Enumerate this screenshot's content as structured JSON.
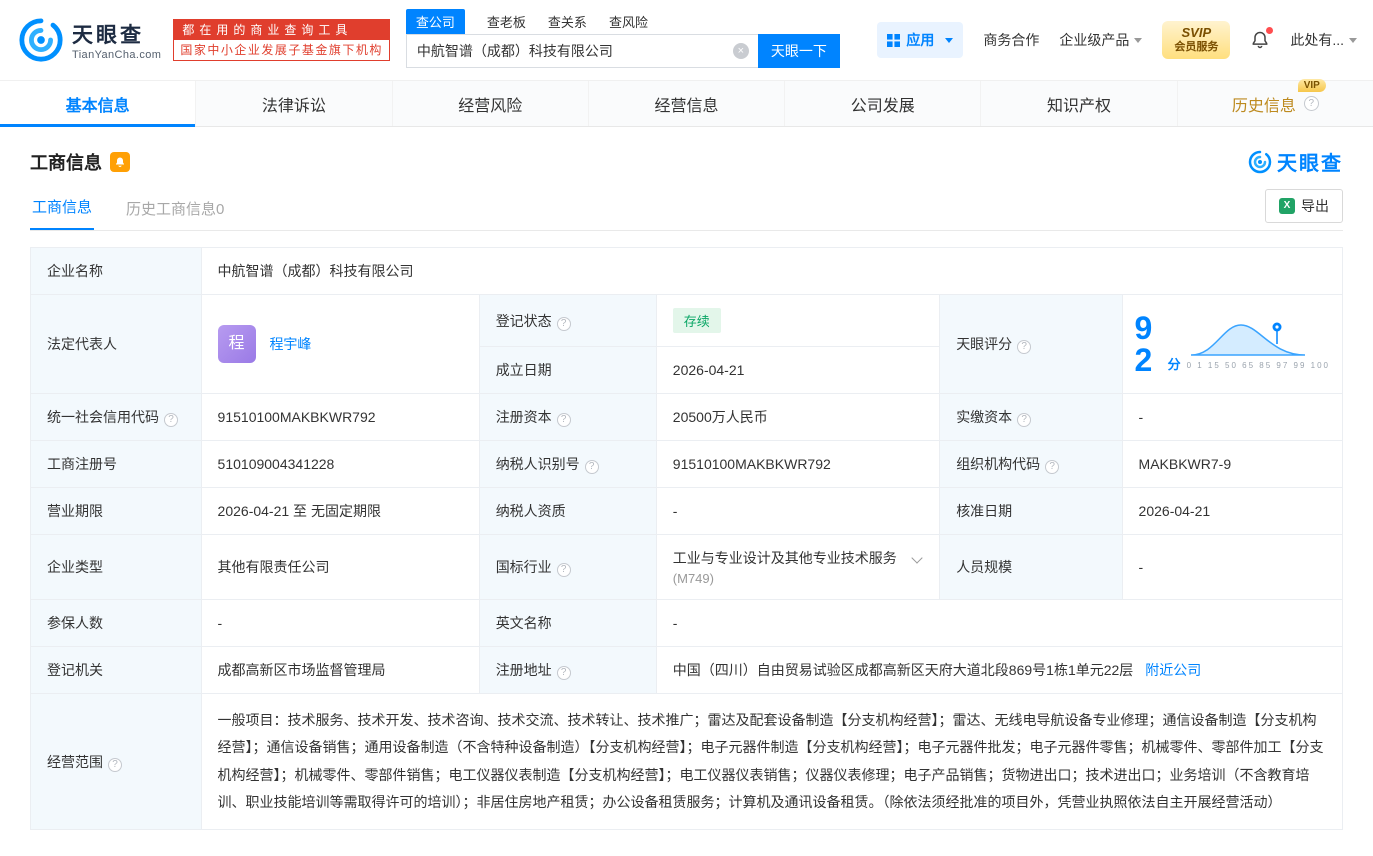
{
  "colors": {
    "primary": "#0084ff",
    "brand_red": "#e03e2d",
    "status_green": "#0aa665",
    "label_bg": "#f3f9fd",
    "history_gold": "#bd8a1f"
  },
  "header": {
    "logo_cn": "天眼查",
    "logo_en": "TianYanCha.com",
    "slogan_line1": "都在用的商业查询工具",
    "slogan_line2": "国家中小企业发展子基金旗下机构",
    "search_tabs": [
      {
        "label": "查公司"
      },
      {
        "label": "查老板"
      },
      {
        "label": "查关系"
      },
      {
        "label": "查风险"
      }
    ],
    "search_value": "中航智谱（成都）科技有限公司",
    "search_button": "天眼一下",
    "nav_apps": "应用",
    "nav_coop": "商务合作",
    "nav_products": "企业级产品",
    "svip_line1": "SVIP",
    "svip_line2": "会员服务",
    "user_label": "此处有..."
  },
  "main_tabs": [
    {
      "label": "基本信息"
    },
    {
      "label": "法律诉讼"
    },
    {
      "label": "经营风险"
    },
    {
      "label": "经营信息"
    },
    {
      "label": "公司发展"
    },
    {
      "label": "知识产权"
    },
    {
      "label": "历史信息",
      "vip": "VIP"
    }
  ],
  "section": {
    "title": "工商信息",
    "brand": "天眼查",
    "subtab_current": "工商信息",
    "subtab_history": "历史工商信息0",
    "export_label": "导出"
  },
  "fields": {
    "company_name": {
      "label": "企业名称",
      "value": "中航智谱（成都）科技有限公司"
    },
    "legal_rep": {
      "label": "法定代表人",
      "avatar": "程",
      "name": "程宇峰"
    },
    "reg_status": {
      "label": "登记状态",
      "value": "存续"
    },
    "establish_date": {
      "label": "成立日期",
      "value": "2026-04-21"
    },
    "tyc_score": {
      "label": "天眼评分",
      "score": "92",
      "unit": "分",
      "axis": "0 1 15 50 65 85 97 99 100"
    },
    "credit_code": {
      "label": "统一社会信用代码",
      "value": "91510100MAKBKWR792"
    },
    "reg_capital": {
      "label": "注册资本",
      "value": "20500万人民币"
    },
    "paid_capital": {
      "label": "实缴资本",
      "value": "-"
    },
    "reg_number": {
      "label": "工商注册号",
      "value": "510109004341228"
    },
    "taxpayer_id": {
      "label": "纳税人识别号",
      "value": "91510100MAKBKWR792"
    },
    "org_code": {
      "label": "组织机构代码",
      "value": "MAKBKWR7-9"
    },
    "business_term": {
      "label": "营业期限",
      "value": "2026-04-21 至 无固定期限"
    },
    "taxpayer_quality": {
      "label": "纳税人资质",
      "value": "-"
    },
    "approval_date": {
      "label": "核准日期",
      "value": "2026-04-21"
    },
    "company_type": {
      "label": "企业类型",
      "value": "其他有限责任公司"
    },
    "industry": {
      "label": "国标行业",
      "value": "工业与专业设计及其他专业技术服务",
      "code": "(M749)"
    },
    "staff_size": {
      "label": "人员规模",
      "value": "-"
    },
    "insured_count": {
      "label": "参保人数",
      "value": "-"
    },
    "english_name": {
      "label": "英文名称",
      "value": "-"
    },
    "reg_authority": {
      "label": "登记机关",
      "value": "成都高新区市场监督管理局"
    },
    "reg_address": {
      "label": "注册地址",
      "value": "中国（四川）自由贸易试验区成都高新区天府大道北段869号1栋1单元22层",
      "link": "附近公司"
    },
    "business_scope": {
      "label": "经营范围",
      "value": "一般项目：技术服务、技术开发、技术咨询、技术交流、技术转让、技术推广；雷达及配套设备制造【分支机构经营】；雷达、无线电导航设备专业修理；通信设备制造【分支机构经营】；通信设备销售；通用设备制造（不含特种设备制造）【分支机构经营】；电子元器件制造【分支机构经营】；电子元器件批发；电子元器件零售；机械零件、零部件加工【分支机构经营】；机械零件、零部件销售；电工仪器仪表制造【分支机构经营】；电工仪器仪表销售；仪器仪表修理；电子产品销售；货物进出口；技术进出口；业务培训（不含教育培训、职业技能培训等需取得许可的培训）；非居住房地产租赁；办公设备租赁服务；计算机及通讯设备租赁。（除依法须经批准的项目外，凭营业执照依法自主开展经营活动）"
    }
  }
}
